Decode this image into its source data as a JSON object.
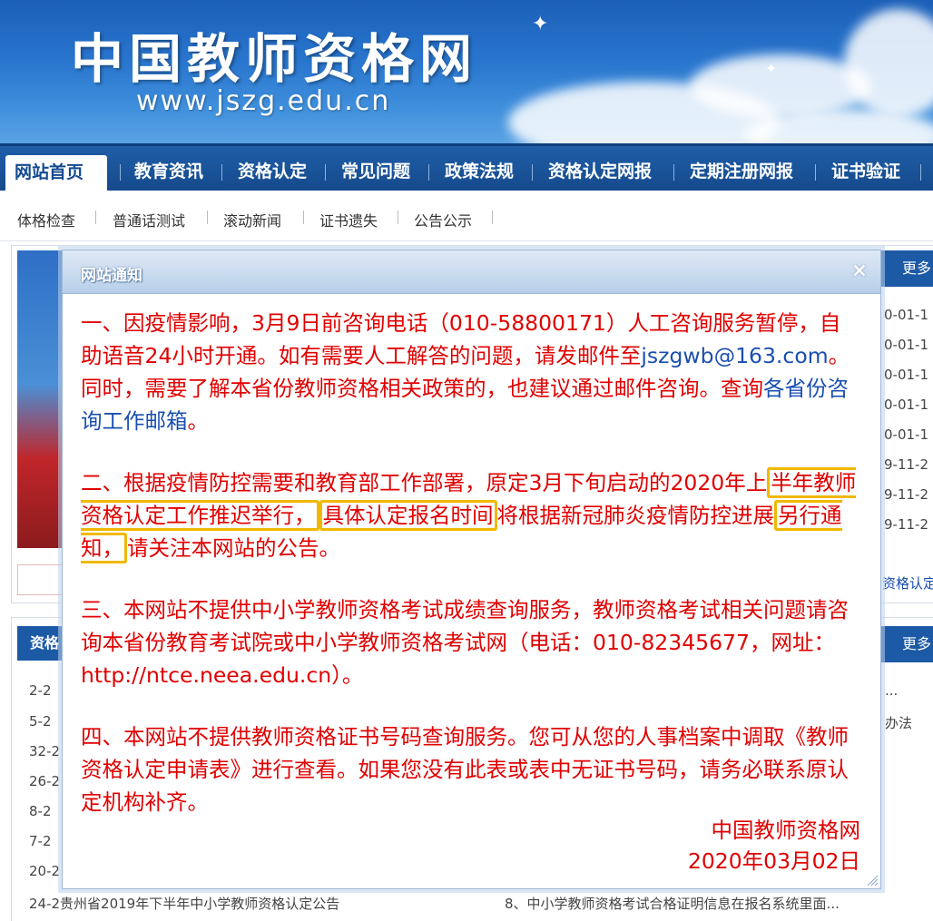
{
  "header": {
    "site_title": "中国教师资格网",
    "site_url": "www.jszg.edu.cn"
  },
  "nav": {
    "items": [
      {
        "label": "网站首页",
        "active": true
      },
      {
        "label": "教育资讯"
      },
      {
        "label": "资格认定"
      },
      {
        "label": "常见问题"
      },
      {
        "label": "政策法规"
      },
      {
        "label": "资格认定网报"
      },
      {
        "label": "定期注册网报"
      },
      {
        "label": "证书验证"
      }
    ]
  },
  "subnav": {
    "items": [
      "体格检查",
      "普通话测试",
      "滚动新闻",
      "证书遗失",
      "公告公示"
    ]
  },
  "background": {
    "more_label_1": "更多",
    "more_label_2": "更多",
    "left_tag": "资格",
    "dates": [
      "0-01-1",
      "0-01-1",
      "0-01-1",
      "0-01-1",
      "0-01-1",
      "9-11-2",
      "9-11-2",
      "9-11-2"
    ],
    "right_snippet": "资格认定",
    "list_prefixes": [
      "2-2",
      "5-2",
      "32-2",
      "26-2",
      "8-2",
      "7-2",
      "20-2"
    ],
    "right_list_snippets": [
      "...",
      "办法"
    ],
    "bottom_left": "24-2贵州省2019年下半年中小学教师资格认定公告",
    "bottom_right": "8、中小学教师资格考试合格证明信息在报名系统里面..."
  },
  "modal": {
    "title": "网站通知",
    "close_symbol": "×",
    "p1_a": "一、因疫情影响，3月9日前咨询电话（010-58800171）人工咨询服务暂停，自助语音24小时开通。如有需要人工解答的问题，请发邮件至",
    "p1_email": "jszgwb@163.com",
    "p1_b": "。同时，需要了解本省份教师资格相关政策的，也建议通过邮件咨询。查询",
    "p1_link": "各省份咨询工作邮箱",
    "p1_c": "。",
    "p2_a": "二、根据疫情防控需要和教育部工作部署，原定3月下旬启动的2020年上",
    "p2_hl1": "半年教师资格认定工作推迟举行，",
    "p2_hl2": "具体认定报名时间",
    "p2_b": "将根据新冠肺炎疫情防控进展",
    "p2_hl3": "另行通知，",
    "p2_c": "请关注本网站的公告。",
    "p3": "三、本网站不提供中小学教师资格考试成绩查询服务，教师资格考试相关问题请咨询本省份教育考试院或中小学教师资格考试网（电话：010-82345677，网址：http://ntce.neea.edu.cn）。",
    "p4": "四、本网站不提供教师资格证书号码查询服务。您可从您的人事档案中调取《教师资格认定申请表》进行查看。如果您没有此表或表中无证书号码，请务必联系原认定机构补齐。",
    "signature_org": "中国教师资格网",
    "signature_date": "2020年03月02日"
  }
}
